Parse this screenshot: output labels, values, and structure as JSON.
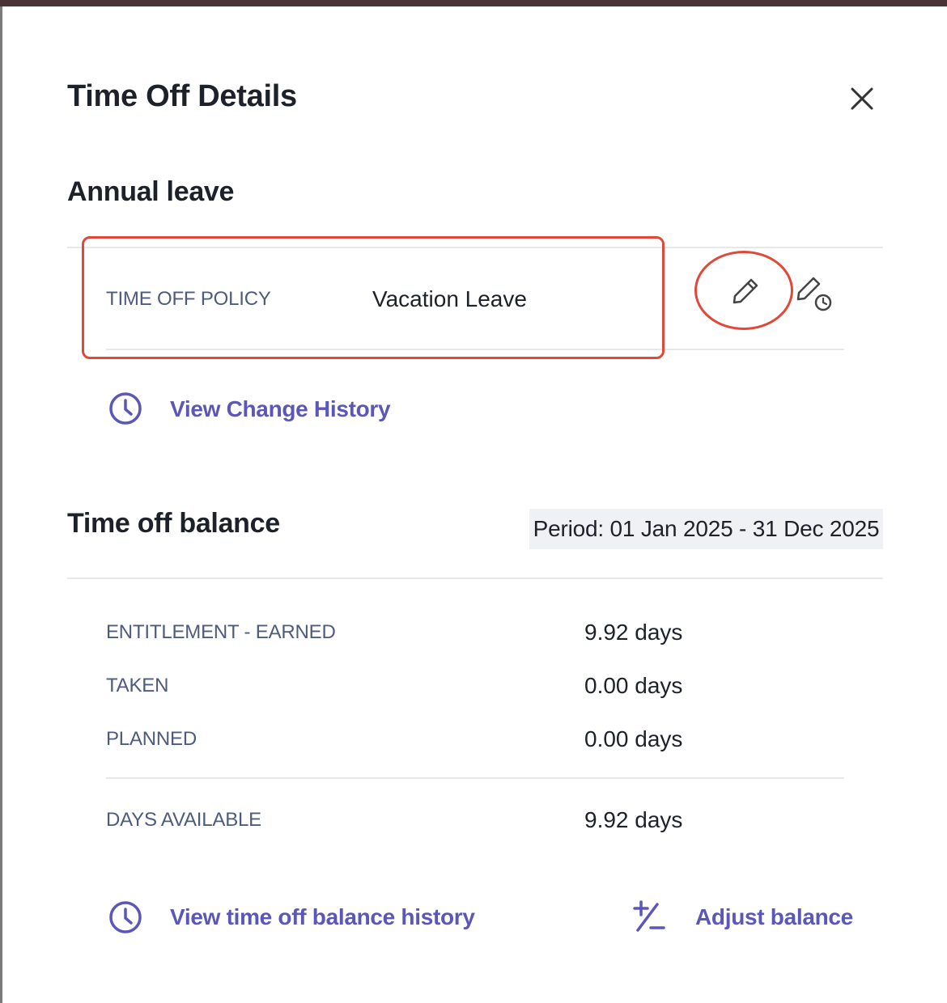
{
  "dialog": {
    "title": "Time Off Details",
    "close_icon": "close-icon"
  },
  "leave": {
    "title": "Annual leave",
    "policy_label": "TIME OFF POLICY",
    "policy_value": "Vacation Leave",
    "edit_icon": "pencil-icon",
    "edit_history_icon": "pencil-clock-icon",
    "change_history_link": "View Change History"
  },
  "balance": {
    "title": "Time off balance",
    "period": "Period: 01 Jan 2025 - 31 Dec 2025",
    "rows": [
      {
        "label": "ENTITLEMENT - EARNED",
        "value": "9.92 days"
      },
      {
        "label": "TAKEN",
        "value": "0.00 days"
      },
      {
        "label": "PLANNED",
        "value": "0.00 days"
      }
    ],
    "available": {
      "label": "DAYS AVAILABLE",
      "value": "9.92 days"
    },
    "history_link": "View time off balance history",
    "adjust_link": "Adjust balance"
  },
  "colors": {
    "accent": "#5b57b8",
    "annotation": "#e0483a",
    "label": "#4d5b7c"
  }
}
